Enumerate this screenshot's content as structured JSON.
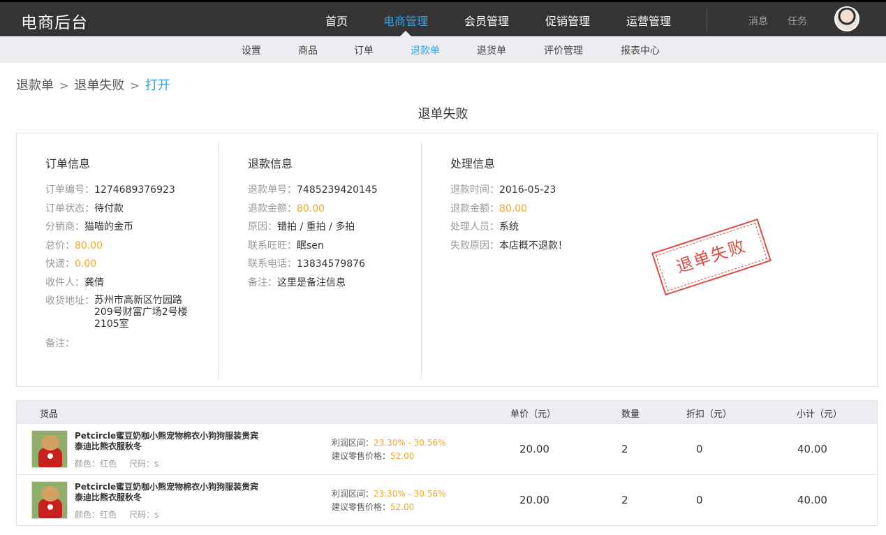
{
  "header": {
    "logo": "电商后台",
    "nav": [
      "首页",
      "电商管理",
      "会员管理",
      "促销管理",
      "运营管理"
    ],
    "active_nav": "电商管理",
    "messages": "消息",
    "tasks": "任务"
  },
  "subnav": {
    "items": [
      "设置",
      "商品",
      "订单",
      "退款单",
      "退货单",
      "评价管理",
      "报表中心"
    ],
    "active": "退款单"
  },
  "breadcrumb": {
    "items": [
      "退款单",
      "退单失败"
    ],
    "current": "打开",
    "separator": ">"
  },
  "page_title": "退单失败",
  "order_info": {
    "title": "订单信息",
    "fields": [
      {
        "label": "订单编号：",
        "value": "1274689376923",
        "highlight": false
      },
      {
        "label": "订单状态：",
        "value": "待付款",
        "highlight": false
      },
      {
        "label": "分销商：",
        "value": "猫喵的金币",
        "highlight": false
      },
      {
        "label": "总价：",
        "value": "80.00",
        "highlight": true
      },
      {
        "label": "快递：",
        "value": "0.00",
        "highlight": true
      },
      {
        "label": "收件人：",
        "value": "龚倩",
        "highlight": false
      }
    ],
    "address_label": "收货地址：",
    "address_value": "苏州市高新区竹园路209号财富广场2号楼2105室",
    "remark_label": "备注：",
    "remark_value": ""
  },
  "refund_info": {
    "title": "退款信息",
    "fields": [
      {
        "label": "退款单号：",
        "value": "7485239420145",
        "highlight": false
      },
      {
        "label": "退款金额：",
        "value": "80.00",
        "highlight": true
      },
      {
        "label": "原因：",
        "value": "错拍 / 重拍 / 多拍",
        "highlight": false
      },
      {
        "label": "联系旺旺：",
        "value": "眠sen",
        "highlight": false
      },
      {
        "label": "联系电话：",
        "value": "13834579876",
        "highlight": false
      },
      {
        "label": "备注：",
        "value": "这里是备注信息",
        "highlight": false
      }
    ]
  },
  "process_info": {
    "title": "处理信息",
    "fields": [
      {
        "label": "退款时间：",
        "value": "2016-05-23",
        "highlight": false
      },
      {
        "label": "退款金额：",
        "value": "80.00",
        "highlight": true
      },
      {
        "label": "处理人员：",
        "value": "系统",
        "highlight": false
      },
      {
        "label": "失败原因：",
        "value": "本店概不退款！",
        "highlight": false
      }
    ],
    "stamp": "退单失败"
  },
  "goods": {
    "headers": {
      "goods": "货品",
      "unit_price": "单价（元）",
      "quantity": "数量",
      "discount": "折扣（元）",
      "subtotal": "小计（元）"
    },
    "rows": [
      {
        "name": "Petcircle蜜豆奶咖小熊宠物棉衣小狗狗服装贵宾泰迪比熊衣服秋冬",
        "color": "颜色：红色",
        "size": "尺码：s",
        "profit_label": "利润区间：",
        "profit_value": "23.30% - 30.56%",
        "retail_label": "建议零售价格：",
        "retail_value": "52.00",
        "unit_price": "20.00",
        "quantity": "2",
        "discount": "0",
        "subtotal": "40.00"
      },
      {
        "name": "Petcircle蜜豆奶咖小熊宠物棉衣小狗狗服装贵宾泰迪比熊衣服秋冬",
        "color": "颜色：红色",
        "size": "尺码：s",
        "profit_label": "利润区间：",
        "profit_value": "23.30% - 30.56%",
        "retail_label": "建议零售价格：",
        "retail_value": "52.00",
        "unit_price": "20.00",
        "quantity": "2",
        "discount": "0",
        "subtotal": "40.00"
      }
    ]
  },
  "colors": {
    "accent": "#35a2e6",
    "highlight": "#f5a623",
    "stamp": "#d9372f",
    "topbar": "#343434"
  }
}
